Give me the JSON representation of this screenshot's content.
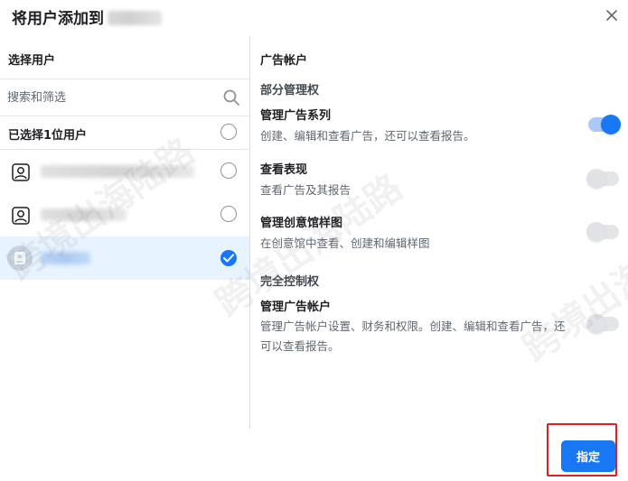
{
  "dialog": {
    "title": "将用户添加到"
  },
  "left_panel": {
    "heading": "选择用户",
    "search": {
      "placeholder": "搜索和筛选",
      "value": ""
    },
    "selected_count_label": "已选择1位用户",
    "users": [
      {
        "name": "",
        "selected": false
      },
      {
        "name": "",
        "selected": false
      },
      {
        "name": "",
        "selected": true
      }
    ]
  },
  "right_panel": {
    "heading": "广告帐户",
    "groups": [
      {
        "label": "部分管理权",
        "permissions": [
          {
            "title": "管理广告系列",
            "description": "创建、编辑和查看广告，还可以查看报告。",
            "enabled": true
          },
          {
            "title": "查看表现",
            "description": "查看广告及其报告",
            "enabled": false
          },
          {
            "title": "管理创意馆样图",
            "description": "在创意馆中查看、创建和编辑样图",
            "enabled": false
          }
        ]
      },
      {
        "label": "完全控制权",
        "permissions": [
          {
            "title": "管理广告帐户",
            "description": "管理广告帐户设置、财务和权限。创建、编辑和查看广告，还可以查看报告。",
            "enabled": false
          }
        ]
      }
    ]
  },
  "footer": {
    "assign_label": "指定"
  },
  "watermark": "跨境出海陆路",
  "colors": {
    "accent": "#1877f2",
    "selected_row": "#e7f3ff",
    "highlight_border": "#e02020"
  }
}
